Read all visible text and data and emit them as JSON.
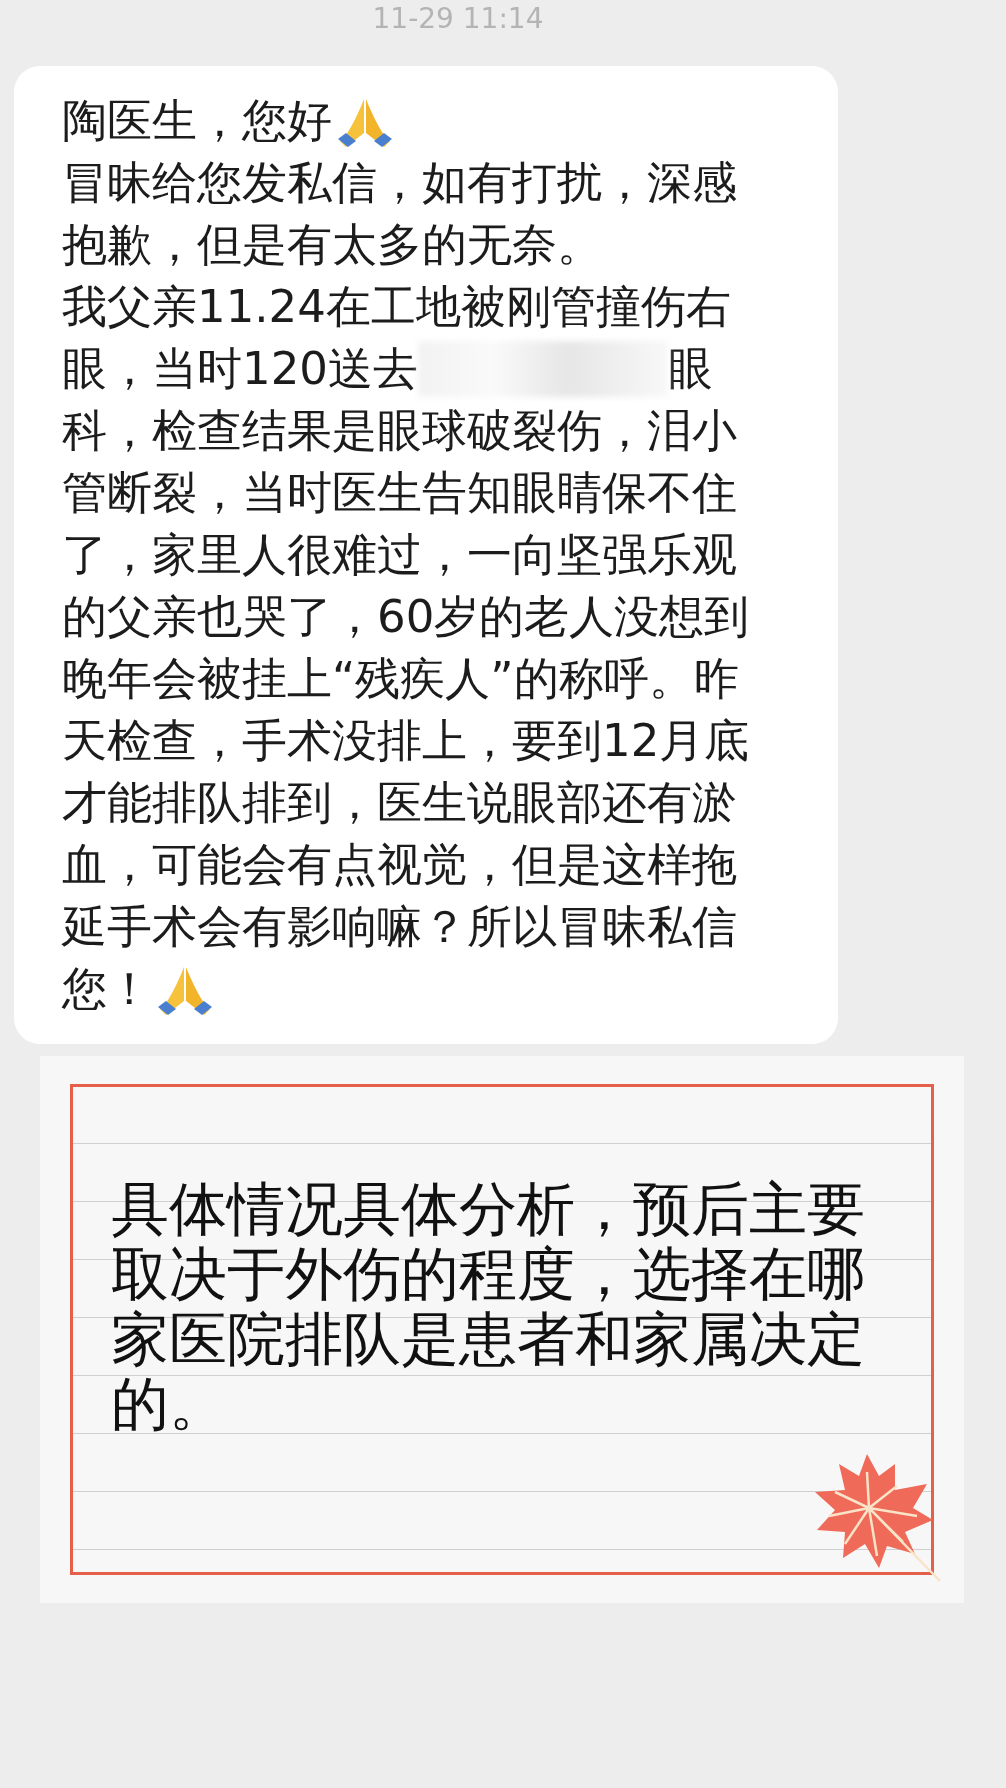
{
  "timestamp": "11-29 11:14",
  "message": {
    "lines": [
      [
        {
          "kind": "text",
          "text": "陶医生，您好"
        },
        {
          "kind": "emoji"
        }
      ],
      [
        {
          "kind": "text",
          "text": "冒昧给您发私信，如有打扰，深感"
        }
      ],
      [
        {
          "kind": "text",
          "text": "抱歉，但是有太多的无奈。"
        }
      ],
      [
        {
          "kind": "text",
          "text": "我父亲11.24在工地被刚管撞伤右"
        }
      ],
      [
        {
          "kind": "text",
          "text": "眼，当时120送去"
        },
        {
          "kind": "redacted"
        },
        {
          "kind": "text",
          "text": "眼"
        }
      ],
      [
        {
          "kind": "text",
          "text": "科，检查结果是眼球破裂伤，泪小"
        }
      ],
      [
        {
          "kind": "text",
          "text": "管断裂，当时医生告知眼睛保不住"
        }
      ],
      [
        {
          "kind": "text",
          "text": "了，家里人很难过，一向坚强乐观"
        }
      ],
      [
        {
          "kind": "text",
          "text": "的父亲也哭了，60岁的老人没想到"
        }
      ],
      [
        {
          "kind": "text",
          "text": "晚年会被挂上“残疾人”的称呼。昨"
        }
      ],
      [
        {
          "kind": "text",
          "text": "天检查，手术没排上，要到12月底"
        }
      ],
      [
        {
          "kind": "text",
          "text": "才能排队排到，医生说眼部还有淤"
        }
      ],
      [
        {
          "kind": "text",
          "text": "血，可能会有点视觉，但是这样拖"
        }
      ],
      [
        {
          "kind": "text",
          "text": "延手术会有影响嘛？所以冒昧私信"
        }
      ],
      [
        {
          "kind": "text",
          "text": "您！"
        },
        {
          "kind": "emoji"
        }
      ]
    ]
  },
  "reply_card": {
    "text": "具体情况具体分析，预后主要取决于外伤的程度，选择在哪家医院排队是患者和家属决定的。"
  }
}
